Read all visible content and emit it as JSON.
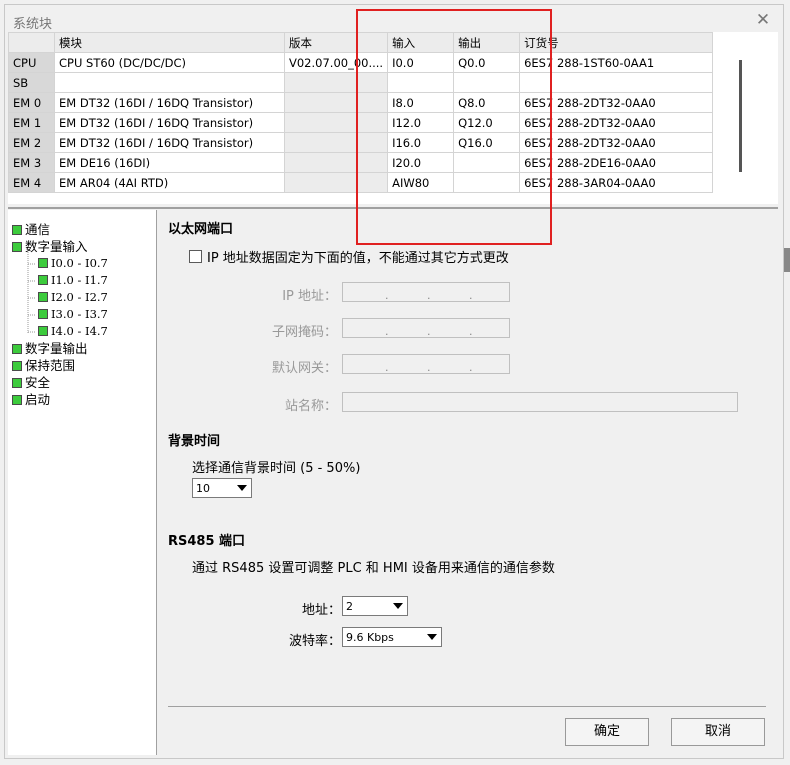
{
  "window": {
    "title": "系统块",
    "close_glyph": "✕"
  },
  "grid": {
    "headers": [
      "",
      "模块",
      "版本",
      "输入",
      "输出",
      "订货号"
    ],
    "rows": [
      {
        "slot": "CPU",
        "module": "CPU ST60 (DC/DC/DC)",
        "version": "V02.07.00_00....",
        "input": "I0.0",
        "output": "Q0.0",
        "order": "6ES7 288-1ST60-0AA1"
      },
      {
        "slot": "SB",
        "module": "",
        "version": "",
        "input": "",
        "output": "",
        "order": ""
      },
      {
        "slot": "EM 0",
        "module": "EM DT32 (16DI / 16DQ Transistor)",
        "version": "",
        "input": "I8.0",
        "output": "Q8.0",
        "order": "6ES7 288-2DT32-0AA0"
      },
      {
        "slot": "EM 1",
        "module": "EM DT32 (16DI / 16DQ Transistor)",
        "version": "",
        "input": "I12.0",
        "output": "Q12.0",
        "order": "6ES7 288-2DT32-0AA0"
      },
      {
        "slot": "EM 2",
        "module": "EM DT32 (16DI / 16DQ Transistor)",
        "version": "",
        "input": "I16.0",
        "output": "Q16.0",
        "order": "6ES7 288-2DT32-0AA0"
      },
      {
        "slot": "EM 3",
        "module": "EM DE16 (16DI)",
        "version": "",
        "input": "I20.0",
        "output": "",
        "order": "6ES7 288-2DE16-0AA0"
      },
      {
        "slot": "EM 4",
        "module": "EM AR04 (4AI RTD)",
        "version": "",
        "input": "AIW80",
        "output": "",
        "order": "6ES7 288-3AR04-0AA0"
      }
    ]
  },
  "tree": {
    "items": [
      {
        "label": "通信",
        "level": 0
      },
      {
        "label": "数字量输入",
        "level": 0
      },
      {
        "label": "I0.0 - I0.7",
        "level": 1
      },
      {
        "label": "I1.0 - I1.7",
        "level": 1
      },
      {
        "label": "I2.0 - I2.7",
        "level": 1
      },
      {
        "label": "I3.0 - I3.7",
        "level": 1
      },
      {
        "label": "I4.0 - I4.7",
        "level": 1
      },
      {
        "label": "数字量输出",
        "level": 0
      },
      {
        "label": "保持范围",
        "level": 0
      },
      {
        "label": "安全",
        "level": 0
      },
      {
        "label": "启动",
        "level": 0
      }
    ]
  },
  "ethernet": {
    "heading": "以太网端口",
    "fixed_ip_label": "IP 地址数据固定为下面的值，不能通过其它方式更改",
    "ip_label": "IP 地址：",
    "subnet_label": "子网掩码：",
    "gateway_label": "默认网关：",
    "station_label": "站名称："
  },
  "background": {
    "heading": "背景时间",
    "desc": "选择通信背景时间 (5 - 50%)",
    "value": "10"
  },
  "rs485": {
    "heading": "RS485 端口",
    "desc": "通过 RS485 设置可调整 PLC 和 HMI 设备用来通信的通信参数",
    "address_label": "地址：",
    "address_value": "2",
    "baud_label": "波特率：",
    "baud_value": "9.6 Kbps"
  },
  "buttons": {
    "ok": "确定",
    "cancel": "取消"
  }
}
